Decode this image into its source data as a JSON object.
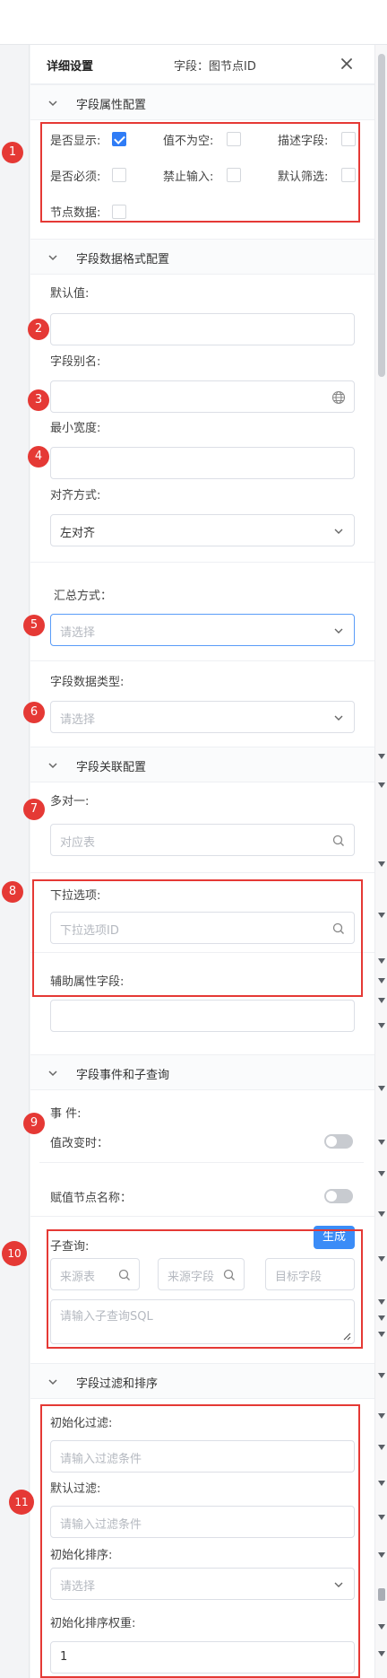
{
  "header": {
    "title": "详细设置",
    "field_label": "字段：图节点ID"
  },
  "sections": {
    "attr": "字段属性配置",
    "format": "字段数据格式配置",
    "relation": "字段关联配置",
    "events": "字段事件和子查询",
    "filter": "字段过滤和排序"
  },
  "attr": {
    "show": "是否显示:",
    "not_null": "值不为空:",
    "describe": "描述字段:",
    "required": "是否必须:",
    "no_input": "禁止输入:",
    "default_filter": "默认筛选:",
    "node_data": "节点数据:"
  },
  "format": {
    "default_label": "默认值:",
    "alias_label": "字段别名:",
    "min_width_label": "最小宽度:",
    "align_label": "对齐方式:",
    "align_value": "左对齐",
    "summary_label": "汇总方式：",
    "summary_placeholder": "请选择",
    "type_label": "字段数据类型:",
    "type_placeholder": "请选择"
  },
  "relation": {
    "many_to_one": "多对一:",
    "many_to_one_placeholder": "对应表",
    "dropdown_label": "下拉选项:",
    "dropdown_placeholder": "下拉选项ID",
    "aux_label": "辅助属性字段:"
  },
  "events": {
    "event_label": "事 件:",
    "on_change": "值改变时：",
    "assign_name": "赋值节点名称：",
    "subquery_label": "子查询:",
    "generate": "生成",
    "source_table": "来源表",
    "source_field": "来源字段",
    "target_field": "目标字段",
    "sql_placeholder": "请输入子查询SQL"
  },
  "filter": {
    "init_filter_label": "初始化过滤:",
    "init_filter_placeholder": "请输入过滤条件",
    "default_filter_label": "默认过滤:",
    "default_filter_placeholder": "请输入过滤条件",
    "init_sort_label": "初始化排序:",
    "init_sort_placeholder": "请选择",
    "sort_weight_label": "初始化排序权重:",
    "sort_weight_value": "1"
  },
  "markers": [
    "1",
    "2",
    "3",
    "4",
    "5",
    "6",
    "7",
    "8",
    "9",
    "10",
    "11"
  ],
  "colors": {
    "accent": "#2f7cf6",
    "annotation": "#e53935",
    "primary_button": "#3b8cf7"
  }
}
